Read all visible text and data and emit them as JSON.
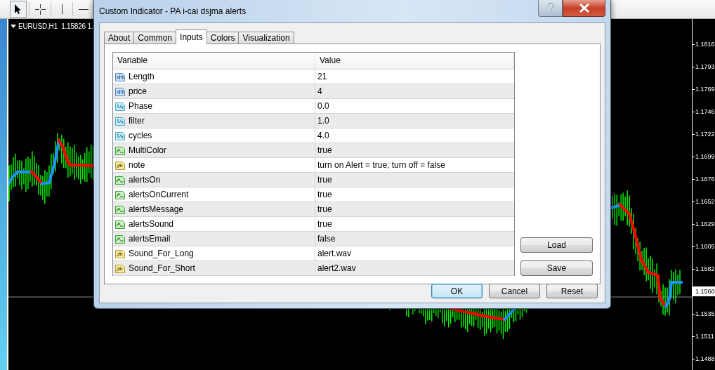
{
  "toolbar": {
    "tools": [
      {
        "kind": "cursor",
        "selected": true
      },
      {
        "kind": "crosshair",
        "selected": false
      },
      {
        "kind": "vline",
        "selected": false
      },
      {
        "kind": "hline",
        "selected": false
      }
    ]
  },
  "chart": {
    "symbol_label": "EURUSD,H1  1.15826 1.",
    "price_axis": [
      {
        "label": "1.1816",
        "current": false
      },
      {
        "label": "1.1793",
        "current": false
      },
      {
        "label": "1.1769",
        "current": false
      },
      {
        "label": "1.1746",
        "current": false
      },
      {
        "label": "1.1722",
        "current": false
      },
      {
        "label": "1.1699",
        "current": false
      },
      {
        "label": "1.1676",
        "current": false
      },
      {
        "label": "1.1652",
        "current": false
      },
      {
        "label": "1.1629",
        "current": false
      },
      {
        "label": "1.1605",
        "current": false
      },
      {
        "label": "1.1582",
        "current": false
      },
      {
        "label": "1.1560",
        "current": true
      },
      {
        "label": "1.1535",
        "current": false
      },
      {
        "label": "1.1511",
        "current": false
      },
      {
        "label": "1.1488",
        "current": false
      }
    ]
  },
  "dialog": {
    "title": "Custom Indicator - PA i-cai dsjma alerts",
    "tabs": [
      {
        "label": "About",
        "selected": false
      },
      {
        "label": "Common",
        "selected": false
      },
      {
        "label": "Inputs",
        "selected": true
      },
      {
        "label": "Colors",
        "selected": false
      },
      {
        "label": "Visualization",
        "selected": false
      }
    ],
    "table": {
      "columns": [
        "Variable",
        "Value"
      ],
      "rows": [
        {
          "kind": "int",
          "variable": "Length",
          "value": "21"
        },
        {
          "kind": "int",
          "variable": "price",
          "value": "4"
        },
        {
          "kind": "double",
          "variable": "Phase",
          "value": "0.0"
        },
        {
          "kind": "double",
          "variable": "filter",
          "value": "1.0"
        },
        {
          "kind": "double",
          "variable": "cycles",
          "value": "4.0"
        },
        {
          "kind": "bool",
          "variable": "MultiColor",
          "value": "true"
        },
        {
          "kind": "string",
          "variable": "note",
          "value": "turn on Alert = true; turn off = false"
        },
        {
          "kind": "bool",
          "variable": "alertsOn",
          "value": "true"
        },
        {
          "kind": "bool",
          "variable": "alertsOnCurrent",
          "value": "true"
        },
        {
          "kind": "bool",
          "variable": "alertsMessage",
          "value": "true"
        },
        {
          "kind": "bool",
          "variable": "alertsSound",
          "value": "true"
        },
        {
          "kind": "bool",
          "variable": "alertsEmail",
          "value": "false"
        },
        {
          "kind": "string",
          "variable": "Sound_For_Long",
          "value": "alert.wav"
        },
        {
          "kind": "string",
          "variable": "Sound_For_Short",
          "value": "alert2.wav"
        }
      ]
    },
    "side_buttons": [
      "Load",
      "Save"
    ],
    "buttons": [
      {
        "label": "OK",
        "focused": true
      },
      {
        "label": "Cancel",
        "focused": false
      },
      {
        "label": "Reset",
        "focused": false
      }
    ]
  }
}
